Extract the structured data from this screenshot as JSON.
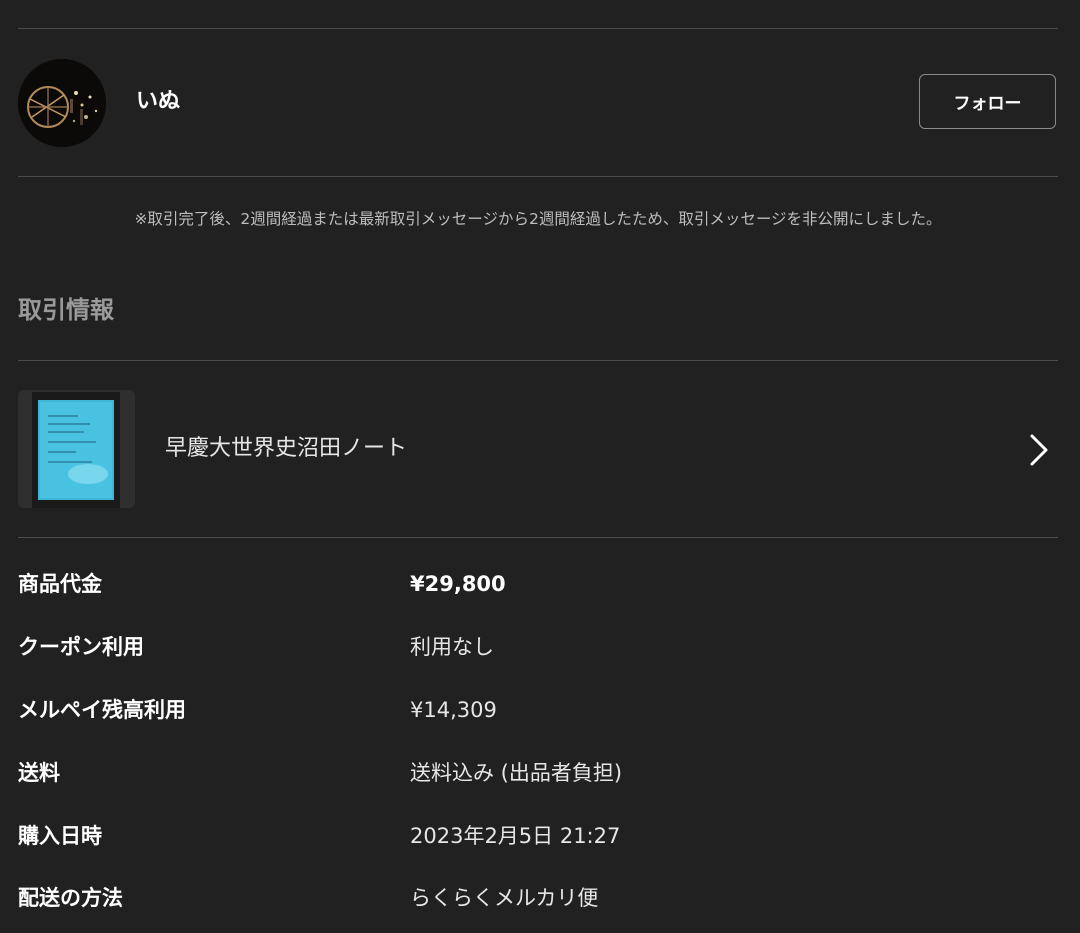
{
  "seller": {
    "name": "いぬ",
    "avatar_icon": "avatar-image",
    "follow_label": "フォロー"
  },
  "notice": "※取引完了後、2週間経過または最新取引メッセージから2週間経過したため、取引メッセージを非公開にしました。",
  "section": {
    "heading": "取引情報"
  },
  "item": {
    "name": "早慶大世界史沼田ノート",
    "thumbnail_icon": "notebook-photo",
    "chevron_icon": "chevron-right-icon"
  },
  "details": [
    {
      "label": "商品代金",
      "value": "¥29,800"
    },
    {
      "label": "クーポン利用",
      "value": "利用なし"
    },
    {
      "label": "メルペイ残高利用",
      "value": "¥14,309"
    },
    {
      "label": "送料",
      "value": "送料込み (出品者負担)"
    },
    {
      "label": "購入日時",
      "value": "2023年2月5日 21:27"
    },
    {
      "label": "配送の方法",
      "value": "らくらくメルカリ便"
    }
  ],
  "colors": {
    "background": "#212121",
    "divider": "#4a4a4a",
    "muted_text": "#bdbdbd",
    "heading_text": "#9a9a9a"
  }
}
